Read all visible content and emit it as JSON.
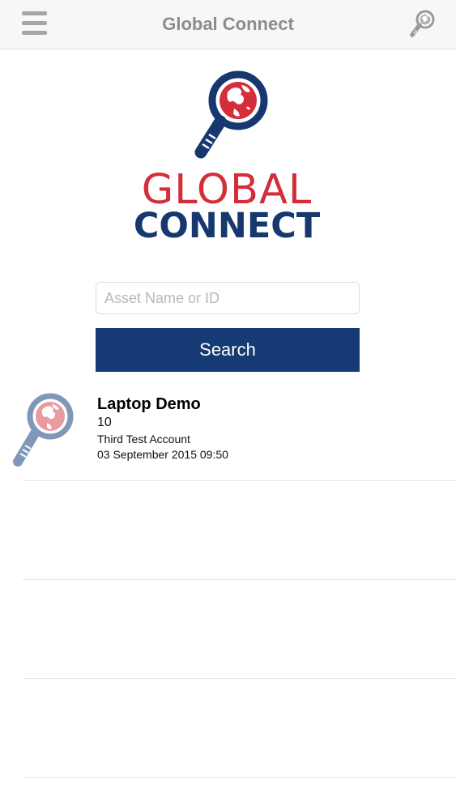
{
  "navbar": {
    "title": "Global Connect",
    "menu_icon": "hamburger-menu-icon",
    "search_icon": "magnifier-globe-icon"
  },
  "logo": {
    "line1": "GLOBAL",
    "line2": "CONNECT",
    "icon": "magnifier-globe-icon",
    "colors": {
      "red": "#d42e3a",
      "navy": "#17386f"
    }
  },
  "search": {
    "placeholder": "Asset Name or ID",
    "value": "",
    "button_label": "Search",
    "button_color": "#163a73"
  },
  "results": [
    {
      "name": "Laptop Demo",
      "id": "10",
      "account": "Third Test Account",
      "date": "03 September 2015 09:50",
      "icon": "magnifier-globe-icon"
    }
  ]
}
